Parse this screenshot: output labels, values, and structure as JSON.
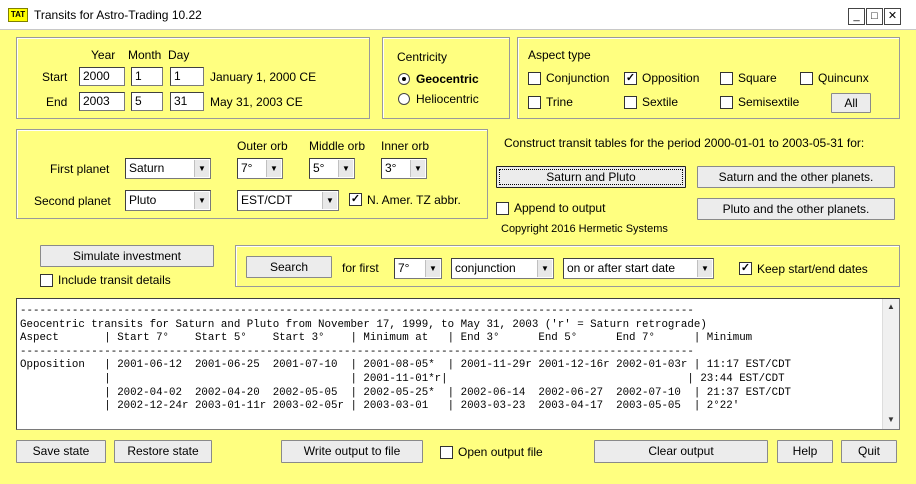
{
  "window": {
    "title": "Transits for Astro-Trading 10.22",
    "icon_label": "TAT",
    "minimize": "_",
    "maximize": "□",
    "close": "✕"
  },
  "date_panel": {
    "year_header": "Year",
    "month_header": "Month",
    "day_header": "Day",
    "start_label": "Start",
    "end_label": "End",
    "start": {
      "year": "2000",
      "month": "1",
      "day": "1",
      "text": "January 1, 2000 CE"
    },
    "end": {
      "year": "2003",
      "month": "5",
      "day": "31",
      "text": "May 31, 2003 CE"
    }
  },
  "centricity": {
    "title": "Centricity",
    "geocentric": "Geocentric",
    "heliocentric": "Heliocentric",
    "selected": "Geocentric"
  },
  "aspect_type": {
    "title": "Aspect type",
    "items": [
      {
        "label": "Conjunction",
        "checked": false
      },
      {
        "label": "Opposition",
        "checked": true
      },
      {
        "label": "Square",
        "checked": false
      },
      {
        "label": "Quincunx",
        "checked": false
      },
      {
        "label": "Trine",
        "checked": false
      },
      {
        "label": "Sextile",
        "checked": false
      },
      {
        "label": "Semisextile",
        "checked": false
      }
    ],
    "all_button": "All"
  },
  "planets": {
    "outer_orb_label": "Outer orb",
    "middle_orb_label": "Middle orb",
    "inner_orb_label": "Inner orb",
    "first_label": "First planet",
    "second_label": "Second planet",
    "first_value": "Saturn",
    "second_value": "Pluto",
    "outer_orb": "7°",
    "middle_orb": "5°",
    "inner_orb": "3°",
    "timezone": "EST/CDT",
    "tz_abbr_label": "N. Amer. TZ abbr.",
    "tz_abbr_checked": true
  },
  "construct": {
    "text": "Construct transit tables for the period 2000-01-01 to 2003-05-31 for:",
    "btn_pair": "Saturn and Pluto",
    "btn_first_others": "Saturn and the other planets.",
    "btn_second_others": "Pluto and the other planets.",
    "append_label": "Append to output",
    "copyright": "Copyright 2016 Hermetic Systems"
  },
  "simulate": {
    "button": "Simulate investment",
    "include_label": "Include transit details"
  },
  "search": {
    "button": "Search",
    "for_first": "for first",
    "orb": "7°",
    "aspect": "conjunction",
    "when": "on or after start date",
    "keep_label": "Keep start/end dates",
    "keep_checked": true
  },
  "output": {
    "lines": [
      "--------------------------------------------------------------------------------------------------------",
      "Geocentric transits for Saturn and Pluto from November 17, 1999, to May 31, 2003 ('r' = Saturn retrograde)",
      "Aspect       | Start 7°    Start 5°    Start 3°    | Minimum at   | End 3°      End 5°      End 7°      | Minimum",
      "--------------------------------------------------------------------------------------------------------",
      "Opposition   | 2001-06-12  2001-06-25  2001-07-10  | 2001-08-05*  | 2001-11-29r 2001-12-16r 2002-01-03r | 11:17 EST/CDT",
      "             |                                     | 2001-11-01*r|                                     | 23:44 EST/CDT",
      "             | 2002-04-02  2002-04-20  2002-05-05  | 2002-05-25*  | 2002-06-14  2002-06-27  2002-07-10  | 21:37 EST/CDT",
      "             | 2002-12-24r 2003-01-11r 2003-02-05r | 2003-03-01   | 2003-03-23  2003-04-17  2003-05-05  | 2°22'"
    ]
  },
  "bottom": {
    "save_state": "Save state",
    "restore_state": "Restore state",
    "write_output": "Write output to file",
    "open_output_label": "Open output file",
    "clear_output": "Clear output",
    "help": "Help",
    "quit": "Quit"
  }
}
